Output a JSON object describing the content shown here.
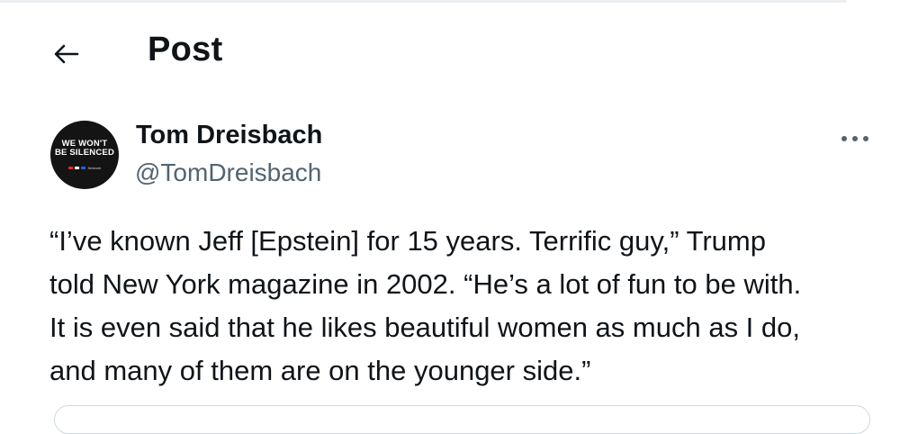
{
  "header": {
    "title": "Post",
    "back_icon": "arrow-left-icon"
  },
  "author": {
    "name": "Tom Dreisbach",
    "handle": "@TomDreisbach",
    "avatar": {
      "line1": "WE WON'T",
      "line2": "BE SILENCED",
      "logo_text": "Network",
      "logo_colors": [
        "#e2272d",
        "#111111",
        "#1a66c8"
      ]
    }
  },
  "more_icon": "more-horizontal-icon",
  "post": {
    "text": "“I’ve known Jeff [Epstein] for 15 years. Terrific guy,” Trump\ntold New York magazine in 2002. “He’s a lot of fun to be with.\nIt is even said that he likes beautiful women as much as I do,\nand many of them are on the younger side.”"
  },
  "colors": {
    "text": "#0f1419",
    "secondary": "#536471",
    "border": "#cfd9de"
  }
}
